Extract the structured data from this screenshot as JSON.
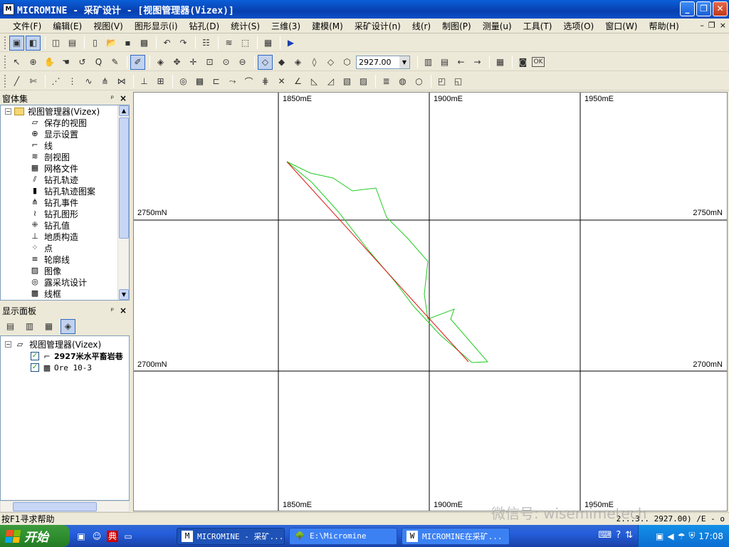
{
  "window": {
    "app_icon": "M",
    "title": "MICROMINE - 采矿设计 - [视图管理器(Vizex)]",
    "buttons": {
      "minimize": "_",
      "restore": "❐",
      "close": "✕"
    }
  },
  "menu": {
    "items": [
      "文件(F)",
      "编辑(E)",
      "视图(V)",
      "图形显示(i)",
      "钻孔(D)",
      "统计(S)",
      "三维(3)",
      "建模(M)",
      "采矿设计(n)",
      "线(r)",
      "制图(P)",
      "测量(u)",
      "工具(T)",
      "选项(O)",
      "窗口(W)",
      "帮助(H)"
    ],
    "mdi_controls": [
      "–",
      "❐",
      "×"
    ]
  },
  "toolbar2": {
    "elevation_value": "2927.00",
    "ok_label": "OK"
  },
  "panel_windows": {
    "title": "窗体集",
    "pin": "ᵖ",
    "close": "×"
  },
  "tree": {
    "root": {
      "label": "视图管理器(Vizex)",
      "expander": "−"
    },
    "items": [
      {
        "label": "保存的视图",
        "icon": "saved-views-icon",
        "glyph": "▱"
      },
      {
        "label": "显示设置",
        "icon": "display-settings-icon",
        "glyph": "⊕"
      },
      {
        "label": "线",
        "icon": "line-icon",
        "glyph": "⌐"
      },
      {
        "label": "剖视图",
        "icon": "section-icon",
        "glyph": "≋"
      },
      {
        "label": "网格文件",
        "icon": "grid-file-icon",
        "glyph": "▦"
      },
      {
        "label": "钻孔轨迹",
        "icon": "drillhole-trace-icon",
        "glyph": "⫽"
      },
      {
        "label": "钻孔轨迹图案",
        "icon": "drillhole-pattern-icon",
        "glyph": "▮"
      },
      {
        "label": "钻孔事件",
        "icon": "drillhole-event-icon",
        "glyph": "⋔"
      },
      {
        "label": "钻孔图形",
        "icon": "drillhole-graph-icon",
        "glyph": "≀"
      },
      {
        "label": "钻孔值",
        "icon": "drillhole-value-icon",
        "glyph": "⁜"
      },
      {
        "label": "地质构造",
        "icon": "geology-structure-icon",
        "glyph": "⊥"
      },
      {
        "label": "点",
        "icon": "points-icon",
        "glyph": "⁘"
      },
      {
        "label": "轮廓线",
        "icon": "contour-icon",
        "glyph": "≡"
      },
      {
        "label": "图像",
        "icon": "image-icon",
        "glyph": "▨"
      },
      {
        "label": "露采坑设计",
        "icon": "pit-design-icon",
        "glyph": "◎"
      },
      {
        "label": "线框",
        "icon": "wireframe-icon",
        "glyph": "▩"
      }
    ]
  },
  "panel_display": {
    "title": "显示面板",
    "pin": "ᵖ",
    "close": "×"
  },
  "display_list": {
    "root": {
      "label": "视图管理器(Vizex)",
      "expander": "−"
    },
    "items": [
      {
        "label": "2927米水平畜岩巷",
        "checked": "✓",
        "bold": true
      },
      {
        "label": "Ore 10-3",
        "checked": "✓",
        "bold": false
      }
    ]
  },
  "view": {
    "top_labels": [
      "1850mE",
      "1900mE",
      "1950mE"
    ],
    "bottom_labels": [
      "1850mE",
      "1900mE",
      "1950mE"
    ],
    "left_labels": [
      "2750mN",
      "2700mN"
    ],
    "right_labels": [
      "2750mN",
      "2700mN"
    ],
    "colors": {
      "outline": "#22cc22",
      "centerline": "#dd1111",
      "grid": "#000000"
    }
  },
  "statusbar": {
    "help": "按F1寻求帮助",
    "coords": "2...3..  2927.00)  /E - o"
  },
  "taskbar": {
    "start_label": "开始",
    "tasks": [
      {
        "label": "MICROMINE - 采矿...",
        "icon": "M",
        "active": true
      },
      {
        "label": "E:\\Micromine",
        "icon": "🌳",
        "active": false
      },
      {
        "label": "MICROMINE在采矿...",
        "icon": "W",
        "active": false
      }
    ],
    "clock": "17:08"
  },
  "watermark": "微信号: wisemimetech"
}
